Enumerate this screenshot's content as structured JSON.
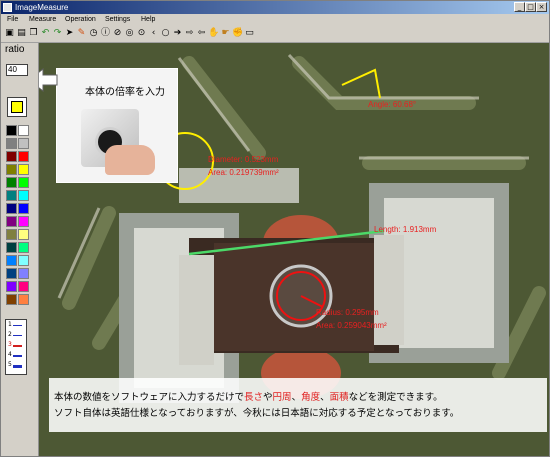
{
  "window": {
    "title": "ImageMeasure",
    "minimize": "_",
    "maximize": "□",
    "close": "×"
  },
  "menu": [
    "File",
    "Measure",
    "Operation",
    "Settings",
    "Help"
  ],
  "toolbar_icons": [
    "open-icon",
    "save-icon",
    "copy-icon",
    "undo-icon",
    "redo-icon",
    "pointer-icon",
    "pencil-icon",
    "clock-icon",
    "info-icon",
    "stop-icon",
    "target-icon",
    "circle-icon",
    "chevron-left-icon",
    "circle-outline-icon",
    "arrow-right-icon",
    "arrow-right-outline-icon",
    "arrow-left-icon",
    "hand-icon",
    "hand-point-icon",
    "hand-grab-icon",
    "document-icon"
  ],
  "sidebar": {
    "ratio_label": "ratio",
    "ratio_value": "40",
    "current_color": "#ffff00",
    "palette": [
      "#000000",
      "#808080",
      "#800000",
      "#808000",
      "#008000",
      "#008080",
      "#000080",
      "#800080",
      "#808040",
      "#004040",
      "#0080ff",
      "#004080",
      "#8000ff",
      "#804000",
      "#ffffff",
      "#c0c0c0",
      "#ff0000",
      "#ffff00",
      "#00ff00",
      "#00ffff",
      "#0000ff",
      "#ff00ff",
      "#ffff80",
      "#00ff80",
      "#80ffff",
      "#8080ff",
      "#ff0080",
      "#ff8040"
    ],
    "line_widths": [
      "1",
      "2",
      "3",
      "4",
      "5"
    ]
  },
  "callout": {
    "text": "本体の倍率を入力"
  },
  "measurements": {
    "angle": "Angle: 60.68°",
    "diameter": "Diameter: 0.523mm",
    "diameter_area": "Area: 0.219739mm²",
    "length": "Length: 1.913mm",
    "radius": "Radius: 0.295mm",
    "radius_area": "Area: 0.259043mm²"
  },
  "info": {
    "line1_a": "本体の数値をソフトウェアに入力するだけで",
    "line1_hl1": "長さ",
    "line1_b": "や",
    "line1_hl2": "円周",
    "line1_c": "、",
    "line1_hl3": "角度",
    "line1_d": "、",
    "line1_hl4": "面積",
    "line1_e": "などを測定できます。",
    "line2": "ソフト自体は英語仕様となっておりますが、今秋には日本語に対応する予定となっております。"
  }
}
